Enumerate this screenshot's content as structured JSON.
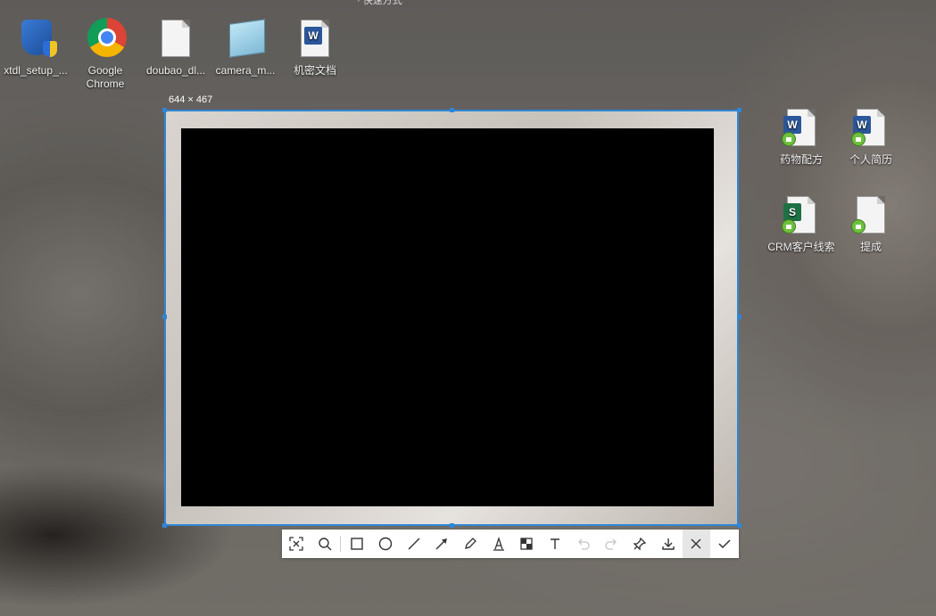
{
  "desktop": {
    "top_caption": "· 快速方式",
    "icons": [
      {
        "label": "xtdl_setup_...",
        "icon": "shield-installer-icon"
      },
      {
        "label": "Google Chrome",
        "icon": "chrome-icon"
      },
      {
        "label": "doubao_dl...",
        "icon": "blank-document-icon"
      },
      {
        "label": "camera_m...",
        "icon": "notepad-icon"
      },
      {
        "label": "机密文档",
        "icon": "word-document-icon"
      },
      {
        "label": "药物配方",
        "icon": "word-document-locked-icon"
      },
      {
        "label": "个人简历",
        "icon": "word-document-locked-icon"
      },
      {
        "label": "CRM客户线索",
        "icon": "spreadsheet-locked-icon"
      },
      {
        "label": "提成",
        "icon": "text-document-locked-icon"
      }
    ]
  },
  "capture": {
    "size_label": "644 × 467",
    "accent_color": "#2f86d6"
  },
  "toolbar": {
    "tools": [
      {
        "name": "auto-select",
        "icon": "scan-frame-icon"
      },
      {
        "name": "zoom",
        "icon": "magnifier-icon"
      },
      {
        "name": "rectangle",
        "icon": "rectangle-icon"
      },
      {
        "name": "ellipse",
        "icon": "circle-icon"
      },
      {
        "name": "line",
        "icon": "line-icon"
      },
      {
        "name": "arrow",
        "icon": "arrow-icon"
      },
      {
        "name": "pencil",
        "icon": "pencil-icon"
      },
      {
        "name": "marker",
        "icon": "highlighter-icon"
      },
      {
        "name": "mosaic",
        "icon": "mosaic-icon"
      },
      {
        "name": "text",
        "icon": "text-icon"
      },
      {
        "name": "undo",
        "icon": "undo-icon"
      },
      {
        "name": "redo",
        "icon": "redo-icon"
      },
      {
        "name": "pin",
        "icon": "pin-icon"
      },
      {
        "name": "save",
        "icon": "download-icon"
      },
      {
        "name": "cancel",
        "icon": "close-icon"
      },
      {
        "name": "confirm",
        "icon": "checkmark-icon"
      }
    ]
  }
}
